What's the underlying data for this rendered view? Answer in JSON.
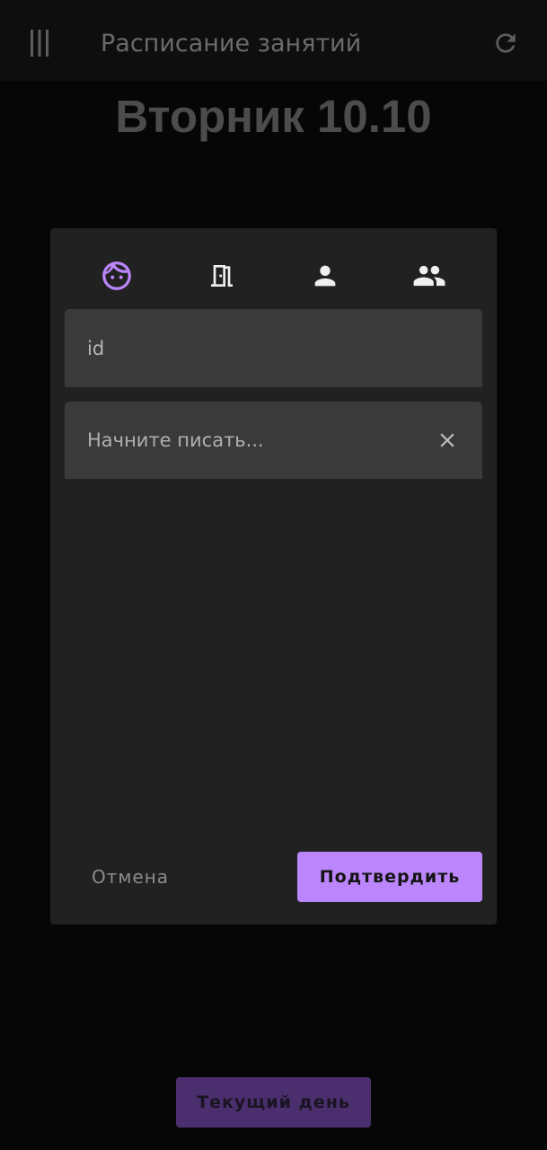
{
  "app_bar": {
    "title": "Расписание занятий",
    "menu_icon": "menu-icon",
    "refresh_icon": "refresh-icon"
  },
  "day_heading": "Вторник 10.10",
  "dialog": {
    "tabs": [
      {
        "icon": "face-icon",
        "active": true
      },
      {
        "icon": "door-icon",
        "active": false
      },
      {
        "icon": "person-icon",
        "active": false
      },
      {
        "icon": "group-icon",
        "active": false
      }
    ],
    "id_field": {
      "value": "id"
    },
    "search_field": {
      "placeholder": "Начните писать...",
      "clear_icon": "close-icon"
    },
    "cancel_label": "Отмена",
    "confirm_label": "Подтвердить"
  },
  "today_button_label": "Текущий день",
  "colors": {
    "accent": "#bb86fc",
    "dialog_background": "#212121",
    "field_background": "#3a3a3a",
    "page_background": "#060606",
    "today_button_background": "#4a2e6d"
  }
}
